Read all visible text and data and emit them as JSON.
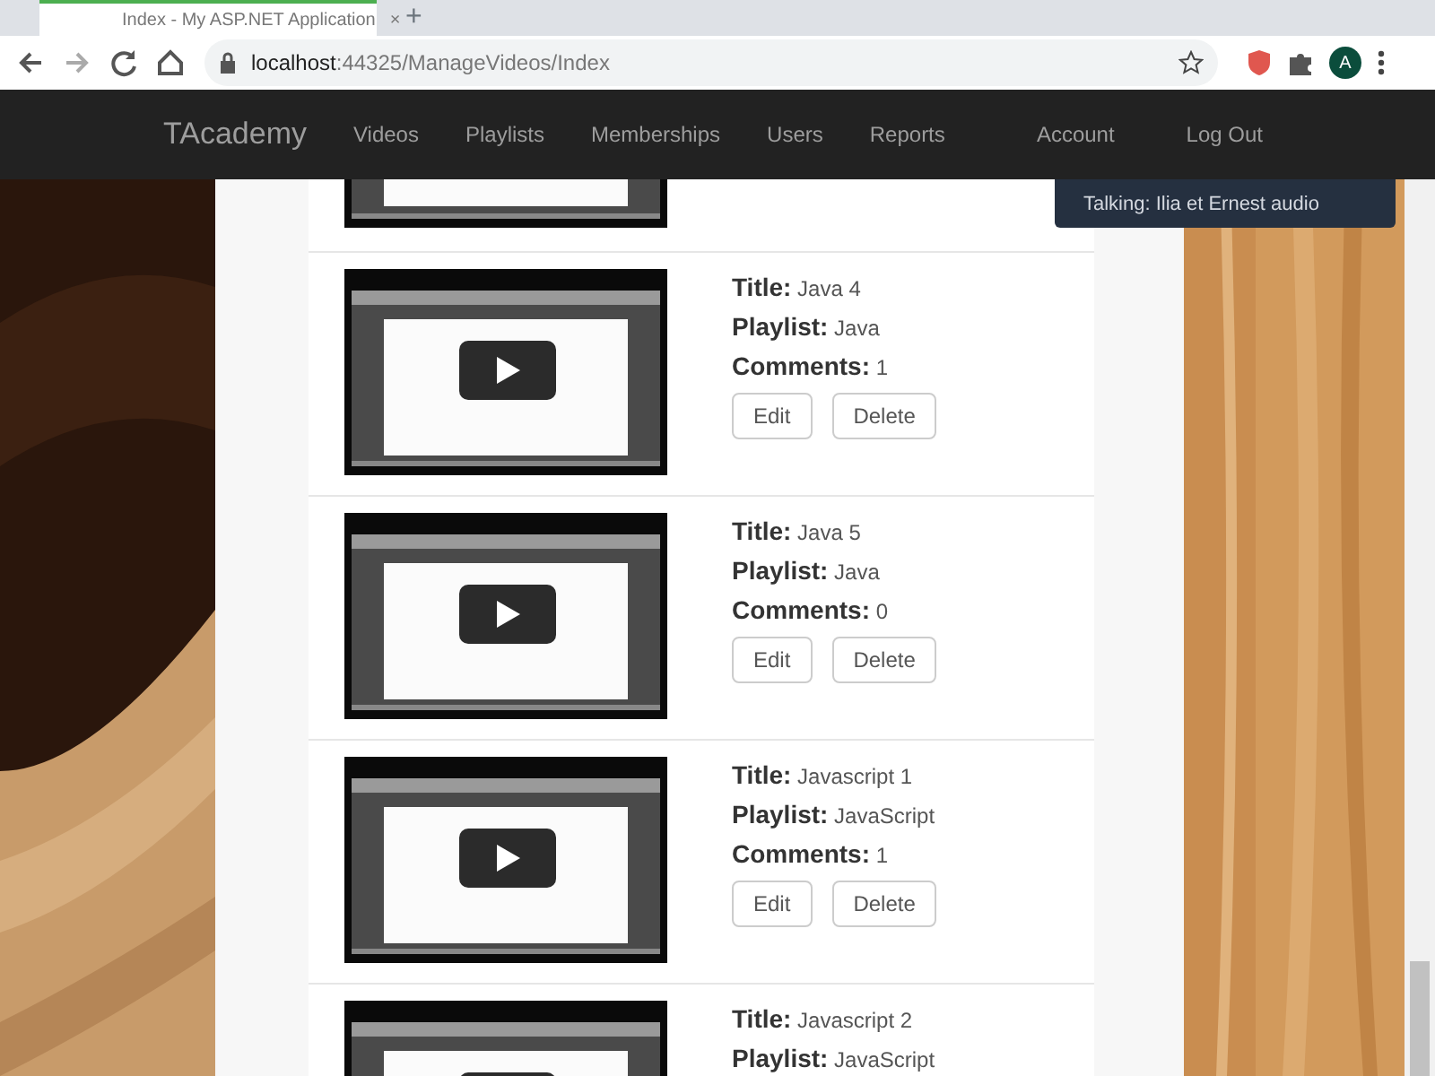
{
  "browser": {
    "tab_title": "Index - My ASP.NET Application",
    "tab_close": "×",
    "new_tab": "+",
    "url_host": "localhost",
    "url_path": ":44325/ManageVideos/Index",
    "profile": "A"
  },
  "navbar": {
    "brand": "TAcademy",
    "links": [
      "Videos",
      "Playlists",
      "Memberships",
      "Users",
      "Reports"
    ],
    "right_links": [
      "Account",
      "Log Out"
    ]
  },
  "tooltip": "Talking: Ilia et Ernest audio",
  "videos": [
    {
      "kind": "partial-top"
    },
    {
      "kind": "full",
      "fields": [
        {
          "label": "Title:",
          "value": "Java 4"
        },
        {
          "label": "Playlist:",
          "value": "Java"
        },
        {
          "label": "Comments:",
          "value": "1"
        }
      ],
      "buttons": [
        "Edit",
        "Delete"
      ]
    },
    {
      "kind": "full",
      "fields": [
        {
          "label": "Title:",
          "value": "Java 5"
        },
        {
          "label": "Playlist:",
          "value": "Java"
        },
        {
          "label": "Comments:",
          "value": "0"
        }
      ],
      "buttons": [
        "Edit",
        "Delete"
      ]
    },
    {
      "kind": "full",
      "fields": [
        {
          "label": "Title:",
          "value": "Javascript 1"
        },
        {
          "label": "Playlist:",
          "value": "JavaScript"
        },
        {
          "label": "Comments:",
          "value": "1"
        }
      ],
      "buttons": [
        "Edit",
        "Delete"
      ]
    },
    {
      "kind": "full",
      "fields": [
        {
          "label": "Title:",
          "value": "Javascript 2"
        },
        {
          "label": "Playlist:",
          "value": "JavaScript"
        }
      ]
    }
  ]
}
